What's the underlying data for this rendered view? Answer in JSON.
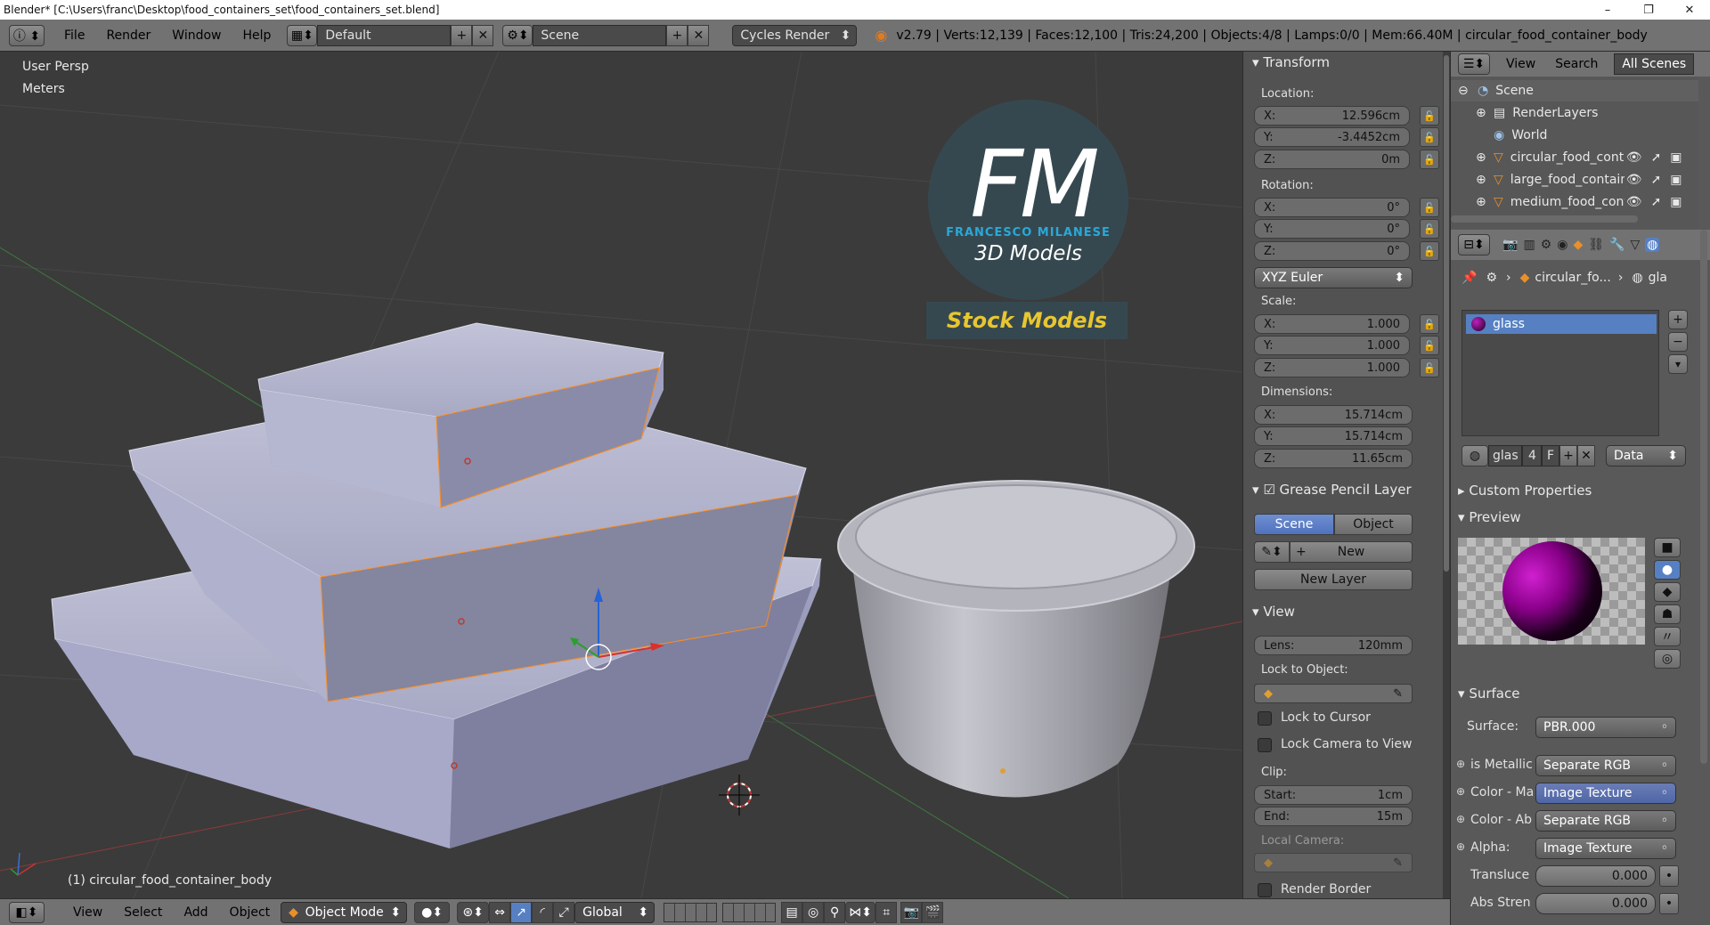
{
  "window": {
    "title": "Blender* [C:\\Users\\franc\\Desktop\\food_containers_set\\food_containers_set.blend]",
    "minimize": "–",
    "maximize": "❐",
    "close": "✕"
  },
  "info_header": {
    "menus": [
      "File",
      "Render",
      "Window",
      "Help"
    ],
    "layout": "Default",
    "scene": "Scene",
    "engine": "Cycles Render",
    "stats": "v2.79 | Verts:12,139 | Faces:12,100 | Tris:24,200 | Objects:4/8 | Lamps:0/0 | Mem:66.40M | circular_food_container_body"
  },
  "viewport": {
    "view_name": "User Persp",
    "units": "Meters",
    "active_object": "(1) circular_food_container_body",
    "logo": {
      "initials": "FM",
      "name": "FRANCESCO MILANESE",
      "subtitle": "3D Models",
      "banner": "Stock Models"
    }
  },
  "npanel": {
    "transform": {
      "title": "Transform",
      "location_label": "Location:",
      "location": [
        {
          "axis": "X:",
          "value": "12.596cm"
        },
        {
          "axis": "Y:",
          "value": "-3.4452cm"
        },
        {
          "axis": "Z:",
          "value": "0m"
        }
      ],
      "rotation_label": "Rotation:",
      "rotation": [
        {
          "axis": "X:",
          "value": "0°"
        },
        {
          "axis": "Y:",
          "value": "0°"
        },
        {
          "axis": "Z:",
          "value": "0°"
        }
      ],
      "rotation_mode": "XYZ Euler",
      "scale_label": "Scale:",
      "scale": [
        {
          "axis": "X:",
          "value": "1.000"
        },
        {
          "axis": "Y:",
          "value": "1.000"
        },
        {
          "axis": "Z:",
          "value": "1.000"
        }
      ],
      "dimensions_label": "Dimensions:",
      "dimensions": [
        {
          "axis": "X:",
          "value": "15.714cm"
        },
        {
          "axis": "Y:",
          "value": "15.714cm"
        },
        {
          "axis": "Z:",
          "value": "11.65cm"
        }
      ]
    },
    "grease_pencil": {
      "title": "Grease Pencil Layer",
      "tab_scene": "Scene",
      "tab_object": "Object",
      "new": "New",
      "new_layer": "New Layer"
    },
    "view": {
      "title": "View",
      "lens_label": "Lens:",
      "lens_value": "120mm",
      "lock_to_object": "Lock to Object:",
      "lock_to_cursor": "Lock to Cursor",
      "lock_camera": "Lock Camera to View",
      "clip_label": "Clip:",
      "clip_start_label": "Start:",
      "clip_start": "1cm",
      "clip_end_label": "End:",
      "clip_end": "15m",
      "local_camera": "Local Camera:",
      "render_border": "Render Border"
    }
  },
  "outliner": {
    "menu_view": "View",
    "menu_search": "Search",
    "filter": "All Scenes",
    "items": [
      {
        "label": "Scene"
      },
      {
        "label": "RenderLayers"
      },
      {
        "label": "World"
      },
      {
        "label": "circular_food_conta"
      },
      {
        "label": "large_food_containe"
      },
      {
        "label": "medium_food_conta"
      }
    ]
  },
  "properties": {
    "breadcrumb_object": "circular_fo...",
    "breadcrumb_material": "gla",
    "material_slot": "glass",
    "material_name": "glas",
    "users": "4",
    "fake_user": "F",
    "link": "Data",
    "custom_properties": "Custom Properties",
    "preview": "Preview",
    "surface_title": "Surface",
    "rows": [
      {
        "label": "Surface:",
        "value": "PBR.000",
        "style": "gray"
      },
      {
        "label": "is Metallic",
        "value": "Separate RGB",
        "style": "gray"
      },
      {
        "label": "Color - Ma",
        "value": "Image Texture",
        "style": "blue"
      },
      {
        "label": "Color - Ab",
        "value": "Separate RGB",
        "style": "gray"
      },
      {
        "label": "Alpha:",
        "value": "Image Texture",
        "style": "gray"
      },
      {
        "label": "Transluce",
        "value": "0.000",
        "style": "slider"
      },
      {
        "label": "Abs Stren",
        "value": "0.000",
        "style": "slider"
      }
    ]
  },
  "bottom_header": {
    "menus": [
      "View",
      "Select",
      "Add",
      "Object"
    ],
    "mode": "Object Mode",
    "orientation": "Global"
  },
  "colors": {
    "accent_blue": "#5680c2",
    "selection_orange": "#ff8c1a",
    "logo_cyan": "#2aa8d8",
    "logo_yellow": "#e8c630"
  }
}
